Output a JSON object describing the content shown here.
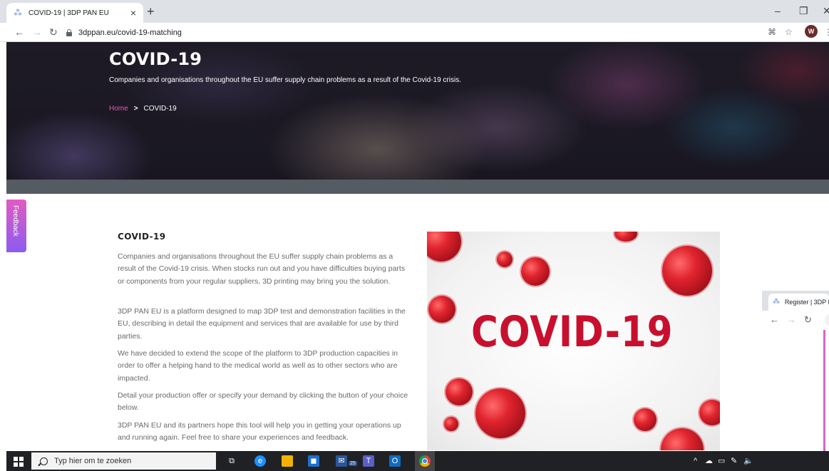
{
  "browser": {
    "tab_title": "COVID-19 | 3DP PAN EU",
    "tab_close": "×",
    "new_tab": "+",
    "url": "3dppan.eu/covid-19-matching",
    "avatar_letter": "W",
    "window_controls": {
      "minimize": "–",
      "restore": "❐",
      "close": "✕"
    },
    "icons": {
      "favicon": "site-favicon",
      "back": "back-arrow-icon",
      "forward": "forward-arrow-icon",
      "reload": "reload-icon",
      "lock": "lock-icon",
      "translate": "translate-icon",
      "star": "star-icon",
      "menu": "menu-icon"
    }
  },
  "hero": {
    "title": "COVID-19",
    "subtitle": "Companies and organisations throughout the EU suffer supply chain problems as a result of the Covid-19 crisis.",
    "breadcrumb": {
      "home": "Home",
      "separator": ">",
      "current": "COVID-19"
    }
  },
  "feedback": {
    "label": "Feedback"
  },
  "article": {
    "title": "COVID-19",
    "paragraphs": [
      "Companies and organisations throughout the EU suffer supply chain problems as a result of the Covid-19 crisis. When stocks run out and you have difficulties buying parts or components from your regular suppliers, 3D printing may bring you the solution.",
      "3DP PAN EU is a platform designed to map 3DP test and demonstration facilities in the EU, describing in detail the equipment and services that are available for use by third parties.",
      "We have decided to extend the scope of the platform to 3DP production capacities in order to offer a helping hand to the medical world as well as to other sectors who are impacted.",
      "Detail your production offer or specify your demand by clicking the button of your choice below.",
      "3DP PAN EU and its partners hope this tool will help you in getting your operations up and running again. Feel free to share your experiences and feedback."
    ],
    "image_text": "COVID-19"
  },
  "side_window": {
    "tab_title": "Register | 3DP I"
  },
  "taskbar": {
    "search_placeholder": "Typ hier om te zoeken",
    "mail_badge": "25",
    "colors": {
      "taskbar": "#202124",
      "edge": "#1e90ff",
      "store": "#1e6fd0",
      "outlook": "#0f6cbd",
      "teams": "#5b5fc7"
    }
  },
  "colors": {
    "accent_pink": "#e05ab0",
    "covid_red": "#c8102e"
  }
}
